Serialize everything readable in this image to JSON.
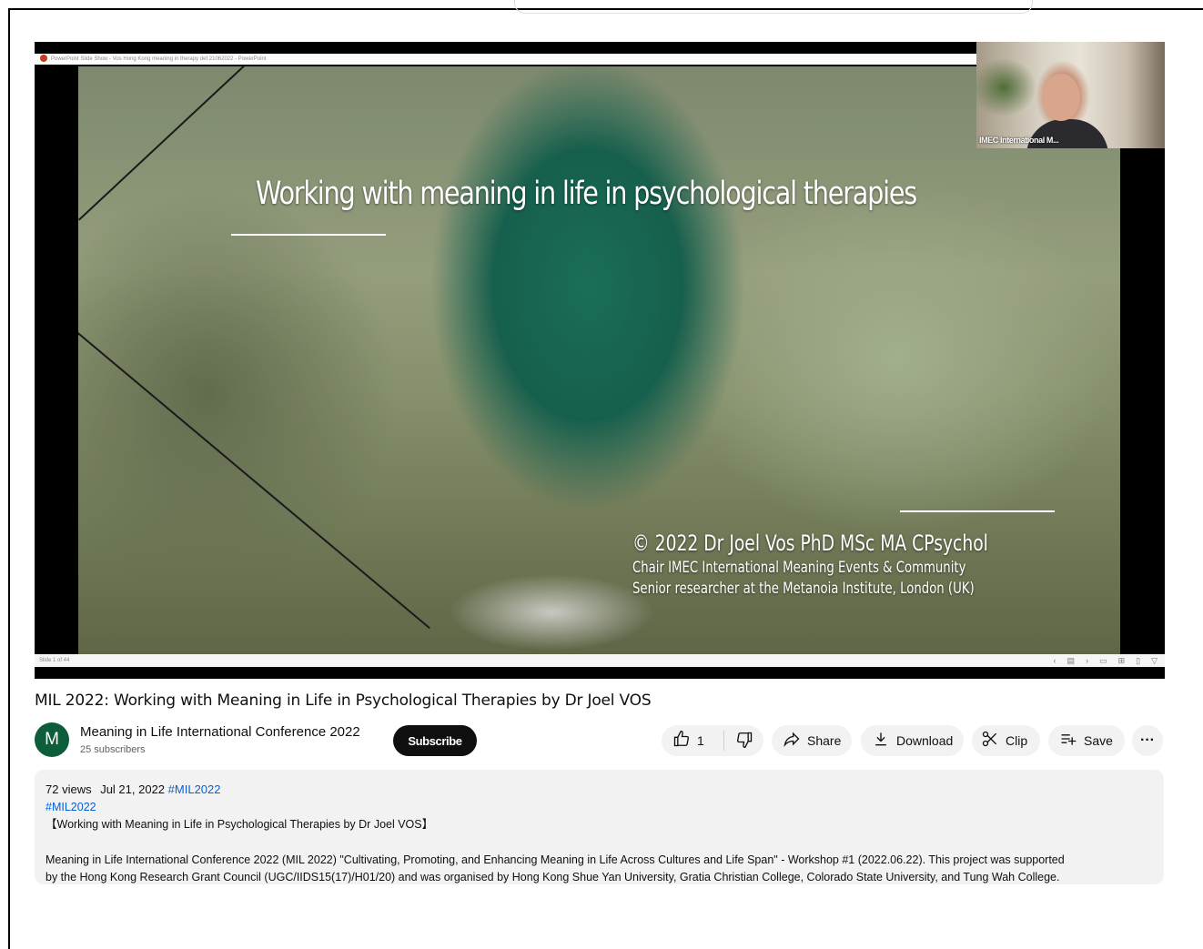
{
  "player": {
    "pp_title": "PowerPoint Slide Show  -  Vos Hong Kong meaning in therapy def 21062022  -  PowerPoint",
    "slide_counter": "Slide 1 of 44",
    "slide": {
      "title": "Working with meaning in life in psychological therapies",
      "credit_line1": "© 2022 Dr Joel Vos PhD MSc MA CPsychol",
      "credit_line2": "Chair IMEC International Meaning Events & Community",
      "credit_line3": "Senior researcher at the Metanoia Institute, London (UK)"
    },
    "webcam_label": "IMEC International M..."
  },
  "video": {
    "title": "MIL 2022: Working with Meaning in Life in Psychological Therapies by Dr Joel VOS"
  },
  "channel": {
    "avatar_letter": "M",
    "name": "Meaning in Life International Conference 2022",
    "subscribers": "25 subscribers",
    "subscribe_label": "Subscribe"
  },
  "actions": {
    "like_count": "1",
    "share_label": "Share",
    "download_label": "Download",
    "clip_label": "Clip",
    "save_label": "Save",
    "more_label": "···"
  },
  "icons": {
    "like": "thumbs-up-icon",
    "dislike": "thumbs-down-icon",
    "share": "share-arrow-icon",
    "download": "download-icon",
    "clip": "scissors-icon",
    "save": "playlist-add-icon"
  },
  "description": {
    "views": "72 views",
    "date": "Jul 21, 2022",
    "hashtag_inline": "#MIL2022",
    "hashtag_line": "#MIL2022",
    "subtitle": "【Working with Meaning in Life in Psychological Therapies by Dr Joel VOS】",
    "body_line1": "Meaning in Life International Conference 2022 (MIL 2022) \"Cultivating, Promoting, and Enhancing Meaning in Life Across Cultures and Life Span\" - Workshop #1 (2022.06.22). This project was supported",
    "body_line2": "by the Hong Kong Research Grant Council (UGC/IIDS15(17)/H01/20) and was organised by Hong Kong Shue Yan University, Gratia Christian College, Colorado State University, and Tung Wah College."
  },
  "colors": {
    "subscribe_bg": "#0f0f0f",
    "pill_bg": "#f2f2f2",
    "hashtag": "#065fd4",
    "avatar_bg": "#0d5c3a"
  }
}
